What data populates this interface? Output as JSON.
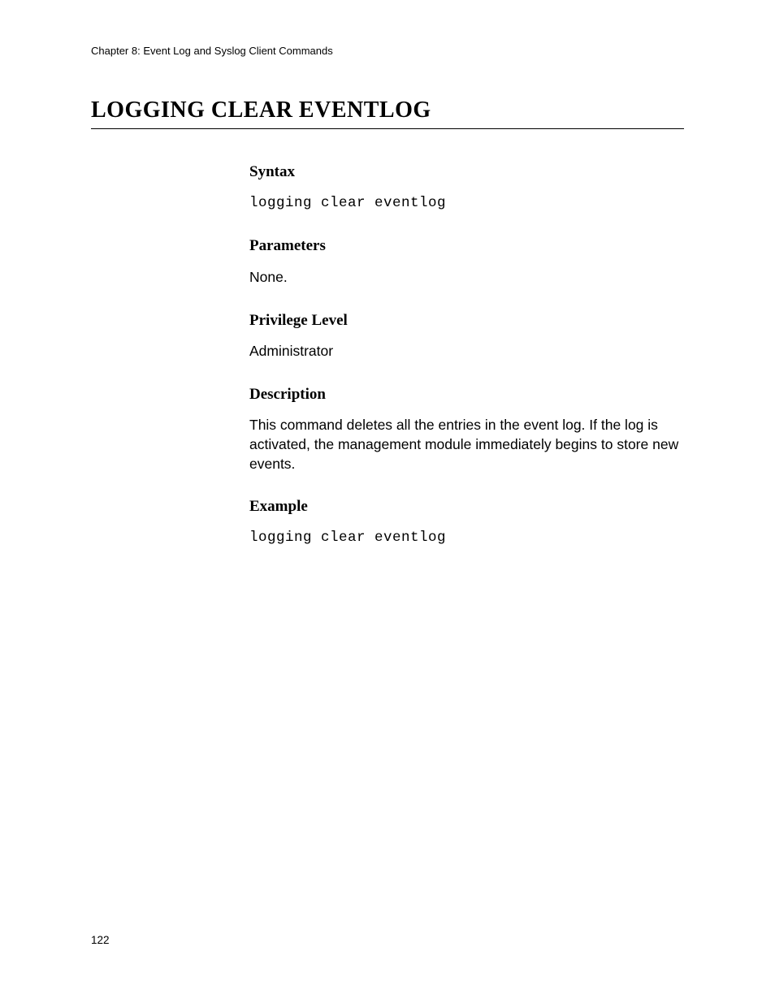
{
  "header": {
    "chapter": "Chapter 8: Event Log and Syslog Client Commands"
  },
  "title": "LOGGING CLEAR EVENTLOG",
  "sections": {
    "syntax": {
      "heading": "Syntax",
      "body": "logging clear eventlog"
    },
    "parameters": {
      "heading": "Parameters",
      "body": "None."
    },
    "privilege": {
      "heading": "Privilege Level",
      "body": "Administrator"
    },
    "description": {
      "heading": "Description",
      "body": "This command deletes all the entries in the event log. If the log is activated, the management module immediately begins to store new events."
    },
    "example": {
      "heading": "Example",
      "body": "logging clear eventlog"
    }
  },
  "footer": {
    "page_number": "122"
  }
}
